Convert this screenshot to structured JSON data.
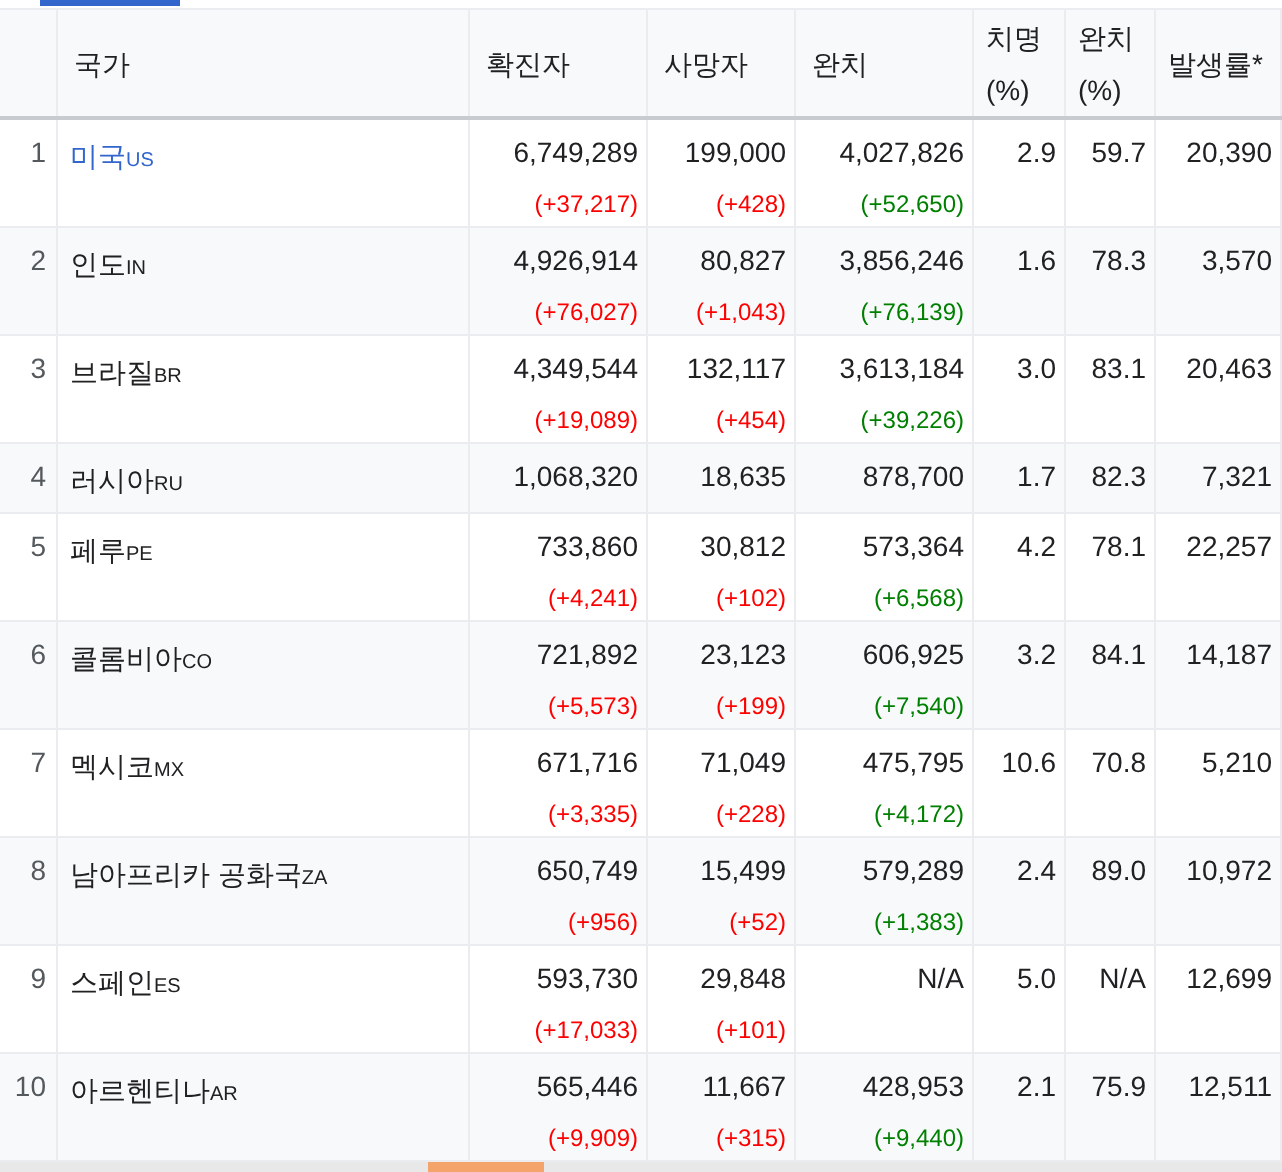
{
  "columns": [
    {},
    {
      "label": "국가"
    },
    {
      "label": "확진자"
    },
    {
      "label": "사망자"
    },
    {
      "label": "완치"
    },
    {
      "label": "치명 (%)"
    },
    {
      "label": "완치 (%)"
    },
    {
      "label": "발생률*"
    }
  ],
  "rows": [
    {
      "rank": "1",
      "country": "미국",
      "code": "US",
      "link": true,
      "confirmed": "6,749,289",
      "confirmed_delta": "(+37,217)",
      "deaths": "199,000",
      "deaths_delta": "(+428)",
      "recovered": "4,027,826",
      "recovered_delta": "(+52,650)",
      "fatality": "2.9",
      "recovery": "59.7",
      "incidence": "20,390"
    },
    {
      "rank": "2",
      "country": "인도",
      "code": "IN",
      "link": false,
      "confirmed": "4,926,914",
      "confirmed_delta": "(+76,027)",
      "deaths": "80,827",
      "deaths_delta": "(+1,043)",
      "recovered": "3,856,246",
      "recovered_delta": "(+76,139)",
      "fatality": "1.6",
      "recovery": "78.3",
      "incidence": "3,570"
    },
    {
      "rank": "3",
      "country": "브라질",
      "code": "BR",
      "link": false,
      "confirmed": "4,349,544",
      "confirmed_delta": "(+19,089)",
      "deaths": "132,117",
      "deaths_delta": "(+454)",
      "recovered": "3,613,184",
      "recovered_delta": "(+39,226)",
      "fatality": "3.0",
      "recovery": "83.1",
      "incidence": "20,463"
    },
    {
      "rank": "4",
      "country": "러시아",
      "code": "RU",
      "link": false,
      "confirmed": "1,068,320",
      "deaths": "18,635",
      "recovered": "878,700",
      "fatality": "1.7",
      "recovery": "82.3",
      "incidence": "7,321"
    },
    {
      "rank": "5",
      "country": "페루",
      "code": "PE",
      "link": false,
      "confirmed": "733,860",
      "confirmed_delta": "(+4,241)",
      "deaths": "30,812",
      "deaths_delta": "(+102)",
      "recovered": "573,364",
      "recovered_delta": "(+6,568)",
      "fatality": "4.2",
      "recovery": "78.1",
      "incidence": "22,257"
    },
    {
      "rank": "6",
      "country": "콜롬비아",
      "code": "CO",
      "link": false,
      "confirmed": "721,892",
      "confirmed_delta": "(+5,573)",
      "deaths": "23,123",
      "deaths_delta": "(+199)",
      "recovered": "606,925",
      "recovered_delta": "(+7,540)",
      "fatality": "3.2",
      "recovery": "84.1",
      "incidence": "14,187"
    },
    {
      "rank": "7",
      "country": "멕시코",
      "code": "MX",
      "link": false,
      "confirmed": "671,716",
      "confirmed_delta": "(+3,335)",
      "deaths": "71,049",
      "deaths_delta": "(+228)",
      "recovered": "475,795",
      "recovered_delta": "(+4,172)",
      "fatality": "10.6",
      "recovery": "70.8",
      "incidence": "5,210"
    },
    {
      "rank": "8",
      "country": "남아프리카 공화국",
      "code": "ZA",
      "link": false,
      "confirmed": "650,749",
      "confirmed_delta": "(+956)",
      "deaths": "15,499",
      "deaths_delta": "(+52)",
      "recovered": "579,289",
      "recovered_delta": "(+1,383)",
      "fatality": "2.4",
      "recovery": "89.0",
      "incidence": "10,972"
    },
    {
      "rank": "9",
      "country": "스페인",
      "code": "ES",
      "link": false,
      "confirmed": "593,730",
      "confirmed_delta": "(+17,033)",
      "deaths": "29,848",
      "deaths_delta": "(+101)",
      "recovered": "N/A",
      "fatality": "5.0",
      "recovery": "N/A",
      "incidence": "12,699"
    },
    {
      "rank": "10",
      "country": "아르헨티나",
      "code": "AR",
      "link": false,
      "confirmed": "565,446",
      "confirmed_delta": "(+9,909)",
      "deaths": "11,667",
      "deaths_delta": "(+315)",
      "recovered": "428,953",
      "recovered_delta": "(+9,440)",
      "fatality": "2.1",
      "recovery": "75.9",
      "incidence": "12,511"
    }
  ]
}
